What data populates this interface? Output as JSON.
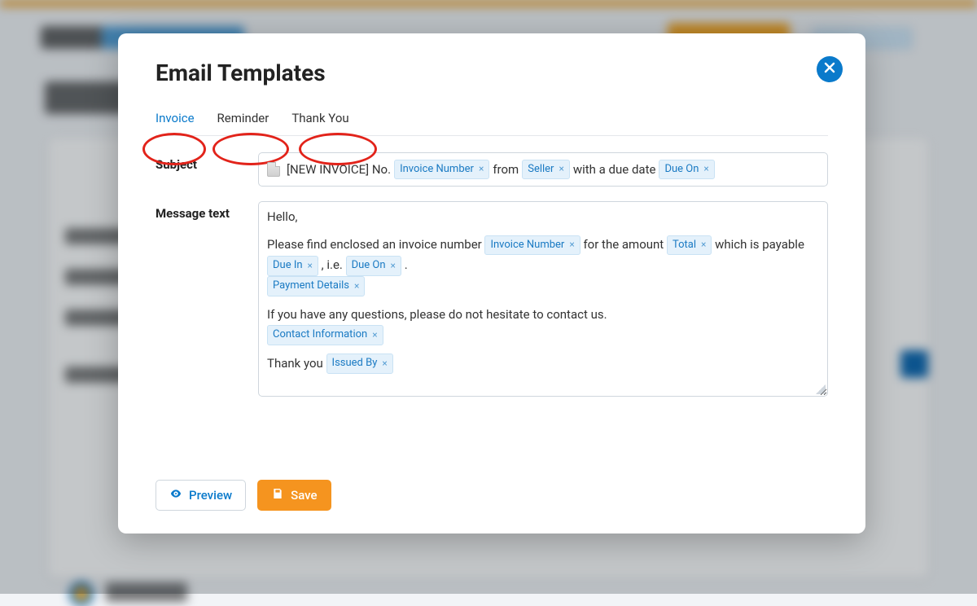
{
  "modal": {
    "title": "Email Templates",
    "tabs": [
      {
        "key": "invoice",
        "label": "Invoice",
        "active": true
      },
      {
        "key": "reminder",
        "label": "Reminder",
        "active": false
      },
      {
        "key": "thankyou",
        "label": "Thank You",
        "active": false
      }
    ],
    "subject": {
      "label": "Subject",
      "prefix": "[NEW INVOICE] No.",
      "between1": "from",
      "between2": "with a due date",
      "tokens": {
        "invoice_number": "Invoice Number",
        "seller": "Seller",
        "due_on": "Due On"
      }
    },
    "message": {
      "label": "Message text",
      "greeting": "Hello,",
      "line1a": "Please find enclosed an invoice number",
      "line1b": "for the amount",
      "line1c": "which is payable",
      "line2a": ", i.e.",
      "line2b": ".",
      "line3": "If you have any questions, please do not hesitate to contact us.",
      "line4a": "Thank you",
      "tokens": {
        "invoice_number": "Invoice Number",
        "total": "Total",
        "due_in": "Due In",
        "due_on": "Due On",
        "payment_details": "Payment Details",
        "contact_information": "Contact Information",
        "issued_by": "Issued By"
      }
    },
    "buttons": {
      "preview": "Preview",
      "save": "Save"
    }
  },
  "colors": {
    "primary_blue": "#0a7acb",
    "primary_orange": "#f5941f",
    "annotation_red": "#e2231a"
  }
}
